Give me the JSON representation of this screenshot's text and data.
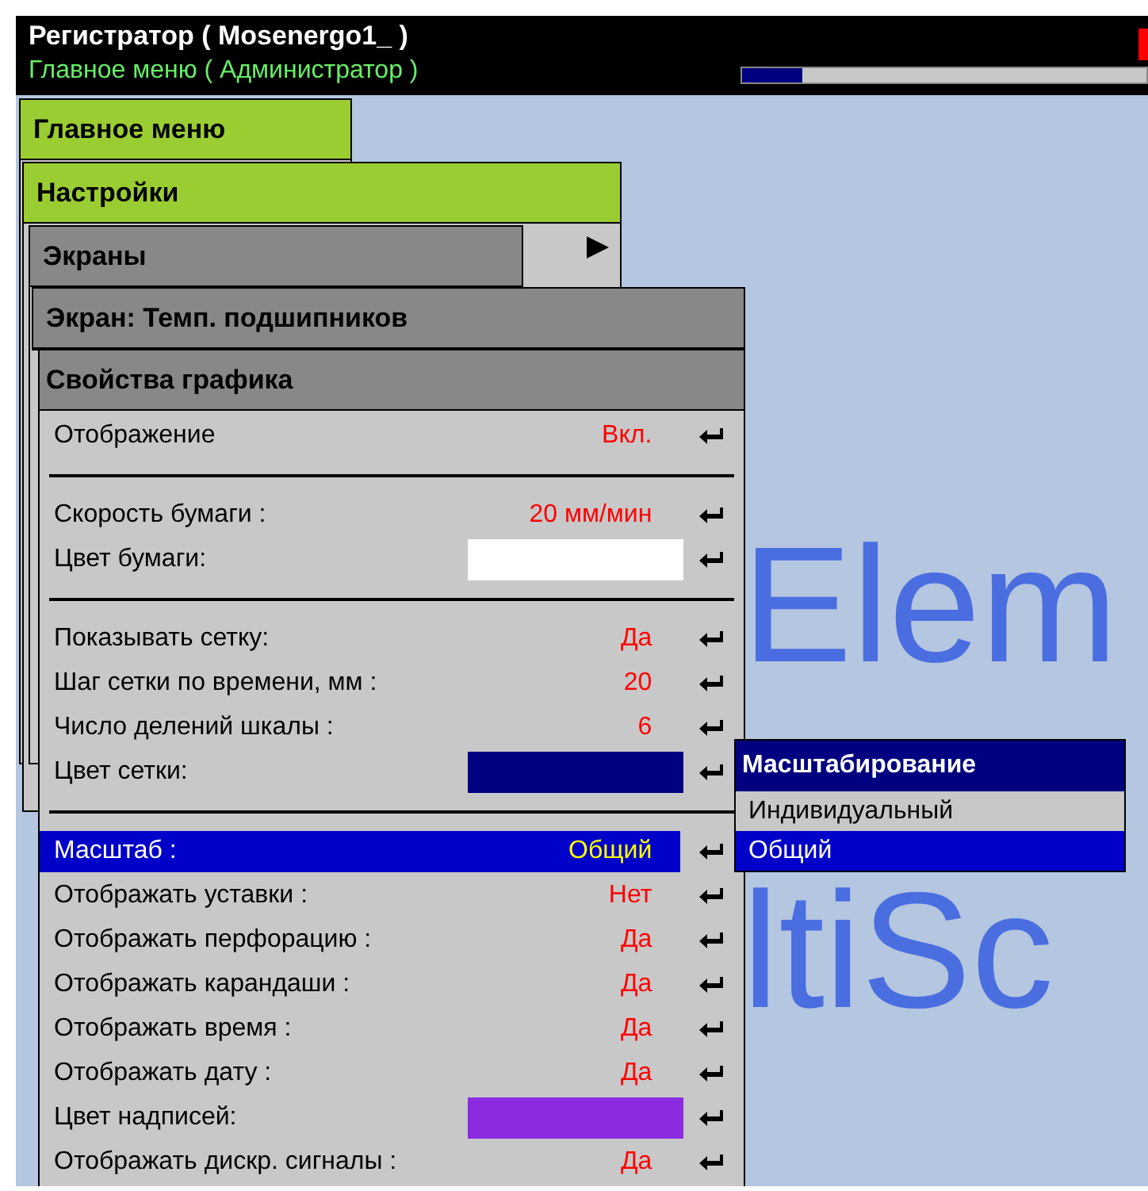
{
  "header": {
    "title": "Регистратор ( Mosenergo1_ )",
    "subtitle": "Главное меню ( Администратор )",
    "progress": {
      "level": 0.15
    }
  },
  "background_logo": [
    "Elem",
    "ltiSc"
  ],
  "menus": [
    {
      "title": "Главное меню",
      "kind": "green"
    },
    {
      "title": "Настройки",
      "kind": "green"
    },
    {
      "title": "Экраны",
      "kind": "gray"
    },
    {
      "title": "Экран: Темп. подшипников",
      "kind": "gray"
    }
  ],
  "panel": {
    "title": "Свойства графика",
    "groups": [
      [
        {
          "label": "Отображение",
          "kind": "text",
          "value": "Вкл.",
          "selected": false
        }
      ],
      [
        {
          "label": "Скорость бумаги :",
          "kind": "text",
          "value": "20 мм/мин",
          "selected": false
        },
        {
          "label": "Цвет бумаги:",
          "kind": "color",
          "color": "#ffffff",
          "selected": false
        }
      ],
      [
        {
          "label": "Показывать сетку:",
          "kind": "text",
          "value": "Да",
          "selected": false
        },
        {
          "label": "Шаг сетки по времени, мм :",
          "kind": "text",
          "value": "20",
          "selected": false
        },
        {
          "label": "Число делений шкалы :",
          "kind": "text",
          "value": "6",
          "selected": false
        },
        {
          "label": "Цвет сетки:",
          "kind": "color",
          "color": "#000080",
          "selected": false
        }
      ],
      [
        {
          "label": "Масштаб :",
          "kind": "text",
          "value": "Общий",
          "selected": true
        },
        {
          "label": "Отображать уставки :",
          "kind": "text",
          "value": "Нет",
          "selected": false
        },
        {
          "label": "Отображать перфорацию :",
          "kind": "text",
          "value": "Да",
          "selected": false
        },
        {
          "label": "Отображать карандаши :",
          "kind": "text",
          "value": "Да",
          "selected": false
        },
        {
          "label": "Отображать время :",
          "kind": "text",
          "value": "Да",
          "selected": false
        },
        {
          "label": "Отображать дату :",
          "kind": "text",
          "value": "Да",
          "selected": false
        },
        {
          "label": "Цвет надписей:",
          "kind": "color",
          "color": "#8a2be2",
          "selected": false
        },
        {
          "label": "Отображать дискр. сигналы :",
          "kind": "text",
          "value": "Да",
          "selected": false
        }
      ]
    ]
  },
  "popup": {
    "title": "Масштабирование",
    "items": [
      {
        "label": "Индивидуальный",
        "selected": false
      },
      {
        "label": "Общий",
        "selected": true
      }
    ]
  }
}
